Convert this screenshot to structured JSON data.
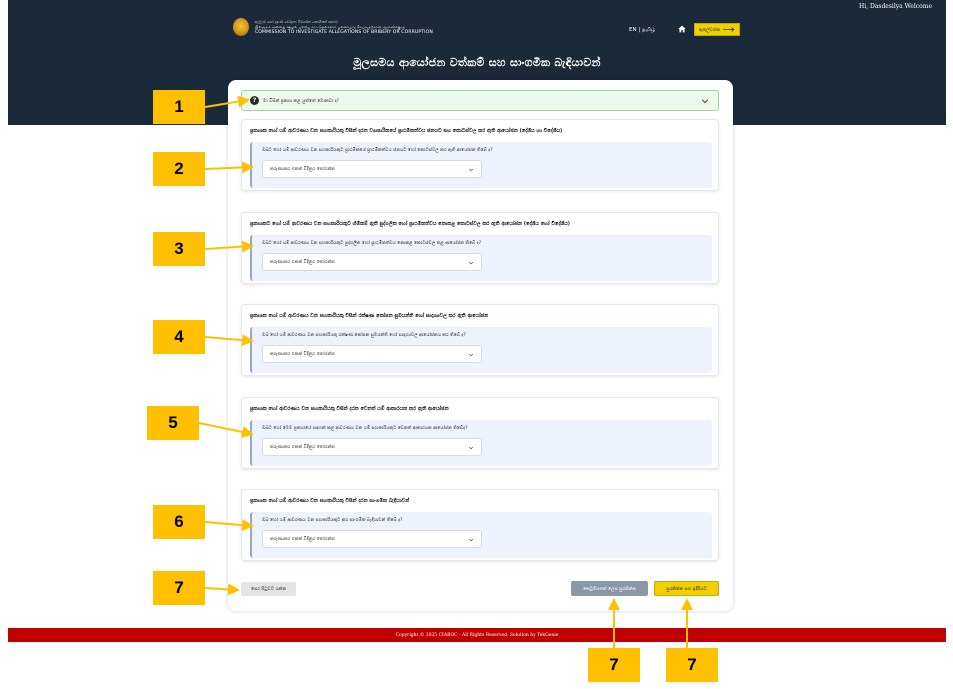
{
  "header": {
    "welcome": "Hi, Dasdesilya Welcome",
    "logo_lines": [
      "අල්ලස් හෝ දූෂණ චෝදනා විමර්ශන කොමිෂන් සභාව",
      "இலஞ்சம் அல்லது ஊழல் பற்றிய சாட்டுதல்களை புலனாய்வு செய்வதற்கான ஆணைக்குழு",
      "COMMISSION TO INVESTIGATE ALLEGATIONS OF BRIBERY OR CORRUPTION"
    ],
    "language": "EN | தமிழ்",
    "enter_button": "ඇතුල්වන්න",
    "page_title": "මූලසමය ආයෝජන වත්කම් සහ සාංගමික බැඳියාවන්"
  },
  "info_bar": {
    "text": "මා විසින් ප්‍රකාශ කළ යුත්තේ මොනවා ද?"
  },
  "sections": [
    {
      "title": "ප්‍රකාශක හෝ යම් ආවරණය වන සහකාරියකු විසින් දරන ව්‍යාපාරිකයේ ප්‍රාථමිකත්වය ජනයට සහ කොටස්වල කර ඇති ආයෝජන (දේශීය හා විදේශීය)",
      "question": "ඔබට හෝ යම් ආවරණය වන සහකාරියකුට ප්‍රාථමිකයේ ප්‍රාථමිකත්වය ජනයට හෝ කොටස්වල කර ඇති ආයෝජන තිබේ ද?",
      "select_value": "කරුණාකර එකක් විදිනුර තෝරන්න"
    },
    {
      "title": "ප්‍රකාශකට හෝ යම් ආවරණය වන සහකාරියකුට හිමිකම් ඇති පුද්ගලික හෝ ප්‍රාථමිකත්වය නොකළ කොටස්වල කර ඇති ආයෝජන (දේශීය හෝ විදේශීය)",
      "question": "ඔබට හෝ යම් ආවරණය වන සහකාරියකුට පුද්ගලික හෝ ප්‍රාථමිකත්වය නොකළ කොටස්වල කළ ආයෝජන තිබේ ද?",
      "select_value": "කරුණාකර එකක් විදිනුර තෝරන්න"
    },
    {
      "title": "ප්‍රකාශක හෝ යම් ආවරණය වන සහකාරියකු විසින් රක්ෂණ කෝපන සුමයන්ති හෝ සාදෘශ්‍යවල කර ඇති ආයෝජන",
      "question": "ඔබ හෝ යම් ආවරණය වන සහකාරියකු රක්ෂණ කෝපන සුමයන්ති හෝ සාදෘශ්‍යවල ආයෝජනය කර තිබේ ද?",
      "select_value": "කරුණාකර එකක් විදිනුර තෝරන්න"
    },
    {
      "title": "ප්‍රකාශක හෝ ආවරණය වන සහකාරියකු විසින් දරන වෙනත් යම් ආකාරයක කර ඇති ආයෝජන",
      "question": "ඔබට හෝ මෙම ප්‍රකාශයේ සඳහන් කළ ආවරණය වන යම් සහකාරියකුට වෙනත් ආකාරයක ආයෝජන තිබේද?",
      "select_value": "කරුණාකර එකක් විදිනුර තෝරන්න"
    },
    {
      "title": "ප්‍රකාශක හෝ යම් ආවරණය වන සහකාරියකු විසින් දරන සාංගමික බැඳියාවන්",
      "question": "ඔබ හෝ යම් ආවරණය වන සහකාරියකුට කර සාංගමික බැඳියාවන් තිබේ ද?",
      "select_value": "කරුණාකර එකක් විදිනුර තෝරන්න"
    }
  ],
  "buttons": {
    "back": "පෙර පිටුවට යන්න",
    "save": "කෙටුම්පතක් ලෙස සුරකින්න",
    "next": "සුරකින්න සහ ඉදිරියට"
  },
  "footer": "Copyright © 2025 CIABOC - All Rights Reserved. Solution by TekGenie",
  "annotations": {
    "markers": [
      "1",
      "2",
      "3",
      "4",
      "5",
      "6",
      "7",
      "7",
      "7"
    ],
    "color": "#ffc000"
  },
  "colors": {
    "header_bg": "#1a2a3b",
    "accent_yellow": "#f0d000",
    "footer_red": "#c00000",
    "info_green": "#eef9ee"
  },
  "icons": [
    "emblem-logo",
    "home-icon",
    "arrow-right-icon",
    "question-icon",
    "chevron-down-icon"
  ]
}
